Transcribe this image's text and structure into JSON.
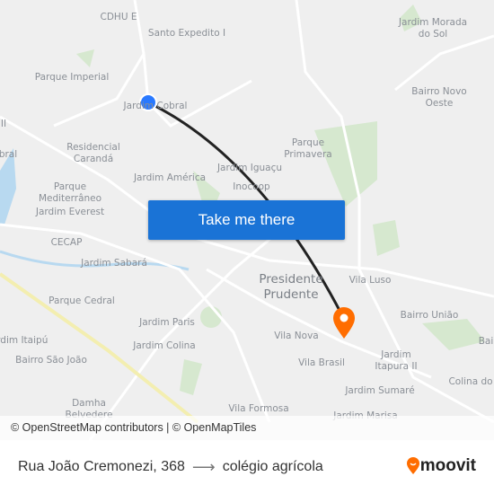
{
  "map": {
    "labels": [
      "CDHU E",
      "Santo Expedito I",
      "Parque Imperial",
      "Jardim Cobral",
      "Residencial\nCarandá",
      "Parque\nMediterrâneo",
      "Jardim Everest",
      "Jardim América",
      "Jardim Iguaçu",
      "Inocoop",
      "CECAP",
      "Jardim Sabará",
      "Parque Cedral",
      "Jardim Paris",
      "Jardim Colina",
      "Jardim Itaipú",
      "Bairro São João",
      "Damha\nBelvedere",
      "Vila Formosa",
      "Vila Nova",
      "Vila Brasil",
      "Jardim Sumaré",
      "Jardim Marisa",
      "Jardim\nItapura II",
      "Colina do",
      "Bairro União",
      "Bai",
      "Vila Luso",
      "Parque\nPrimavera",
      "Bairro Novo\nOeste",
      "Jardim Morada\ndo Sol",
      "bral",
      "II"
    ],
    "city_label": "Presidente\nPrudente",
    "route_color": "#222222",
    "origin_color": "#2979ff",
    "destination_color": "#ff6d00"
  },
  "cta": {
    "label": "Take me there",
    "color": "#1a73d6"
  },
  "attribution": "© OpenStreetMap contributors | © OpenMapTiles",
  "footer": {
    "origin": "Rua João Cremonezi, 368",
    "destination": "colégio agrícola",
    "brand": "moovit",
    "brand_color": "#ff6d00"
  }
}
